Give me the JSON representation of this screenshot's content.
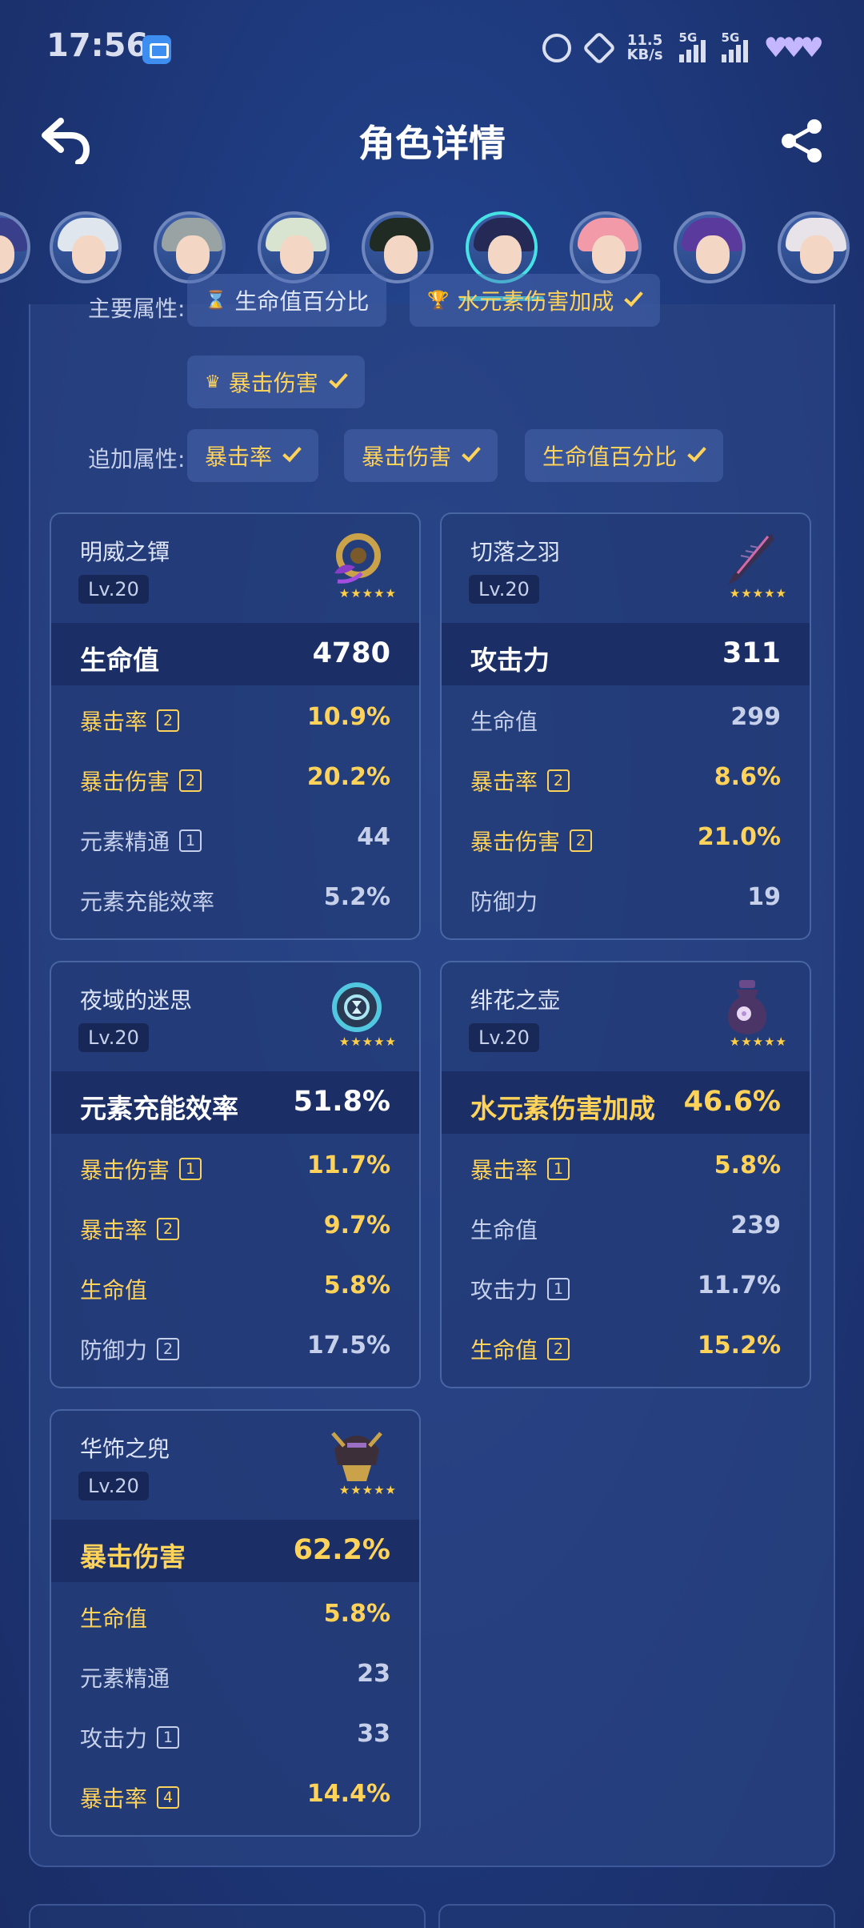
{
  "status": {
    "time": "17:56",
    "speed_value": "11.5",
    "speed_unit": "KB/s",
    "signal1": "5G",
    "signal2": "5G"
  },
  "header": {
    "title": "角色详情"
  },
  "avatars": [
    {
      "hair": "#3a3f8c"
    },
    {
      "hair": "#dfe6ee"
    },
    {
      "hair": "#9aa3a3"
    },
    {
      "hair": "#d9e4d0"
    },
    {
      "hair": "#1f2b23"
    },
    {
      "hair": "#242a55",
      "selected": true
    },
    {
      "hair": "#f29aa8"
    },
    {
      "hair": "#5b3a9e"
    },
    {
      "hair": "#e8e3e8"
    }
  ],
  "attributes": {
    "main_label": "主要属性:",
    "main": [
      "生命值百分比",
      "水元素伤害加成",
      "暴击伤害"
    ],
    "extra_label": "追加属性:",
    "extra": [
      "暴击率",
      "暴击伤害",
      "生命值百分比"
    ]
  },
  "artifacts": [
    {
      "name": "明威之镡",
      "level": "Lv.20",
      "icon": "tsuba-icon",
      "main": {
        "label": "生命值",
        "value": "4780",
        "gold": false
      },
      "subs": [
        {
          "label": "暴击率",
          "count": "2",
          "value": "10.9%",
          "gold": true
        },
        {
          "label": "暴击伤害",
          "count": "2",
          "value": "20.2%",
          "gold": true
        },
        {
          "label": "元素精通",
          "count": "1",
          "value": "44",
          "gold": false
        },
        {
          "label": "元素充能效率",
          "count": "",
          "value": "5.2%",
          "gold": false
        }
      ]
    },
    {
      "name": "切落之羽",
      "level": "Lv.20",
      "icon": "feather-icon",
      "main": {
        "label": "攻击力",
        "value": "311",
        "gold": false
      },
      "subs": [
        {
          "label": "生命值",
          "count": "",
          "value": "299",
          "gold": false
        },
        {
          "label": "暴击率",
          "count": "2",
          "value": "8.6%",
          "gold": true
        },
        {
          "label": "暴击伤害",
          "count": "2",
          "value": "21.0%",
          "gold": true
        },
        {
          "label": "防御力",
          "count": "",
          "value": "19",
          "gold": false
        }
      ]
    },
    {
      "name": "夜域的迷思",
      "level": "Lv.20",
      "icon": "hourglass-icon",
      "main": {
        "label": "元素充能效率",
        "value": "51.8%",
        "gold": false
      },
      "subs": [
        {
          "label": "暴击伤害",
          "count": "1",
          "value": "11.7%",
          "gold": true
        },
        {
          "label": "暴击率",
          "count": "2",
          "value": "9.7%",
          "gold": true
        },
        {
          "label": "生命值",
          "count": "",
          "value": "5.8%",
          "gold": true
        },
        {
          "label": "防御力",
          "count": "2",
          "value": "17.5%",
          "gold": false
        }
      ]
    },
    {
      "name": "绯花之壶",
      "level": "Lv.20",
      "icon": "goblet-icon",
      "main": {
        "label": "水元素伤害加成",
        "value": "46.6%",
        "gold": true
      },
      "subs": [
        {
          "label": "暴击率",
          "count": "1",
          "value": "5.8%",
          "gold": true
        },
        {
          "label": "生命值",
          "count": "",
          "value": "239",
          "gold": false
        },
        {
          "label": "攻击力",
          "count": "1",
          "value": "11.7%",
          "gold": false
        },
        {
          "label": "生命值",
          "count": "2",
          "value": "15.2%",
          "gold": true
        }
      ]
    },
    {
      "name": "华饰之兜",
      "level": "Lv.20",
      "icon": "helmet-icon",
      "main": {
        "label": "暴击伤害",
        "value": "62.2%",
        "gold": true
      },
      "subs": [
        {
          "label": "生命值",
          "count": "",
          "value": "5.8%",
          "gold": true
        },
        {
          "label": "元素精通",
          "count": "",
          "value": "23",
          "gold": false
        },
        {
          "label": "攻击力",
          "count": "1",
          "value": "33",
          "gold": false
        },
        {
          "label": "暴击率",
          "count": "4",
          "value": "14.4%",
          "gold": true
        }
      ]
    }
  ],
  "colors": {
    "gold": "#ffd35a",
    "accent_cyan": "#45e3e6",
    "text_muted": "#c6d0ea"
  }
}
